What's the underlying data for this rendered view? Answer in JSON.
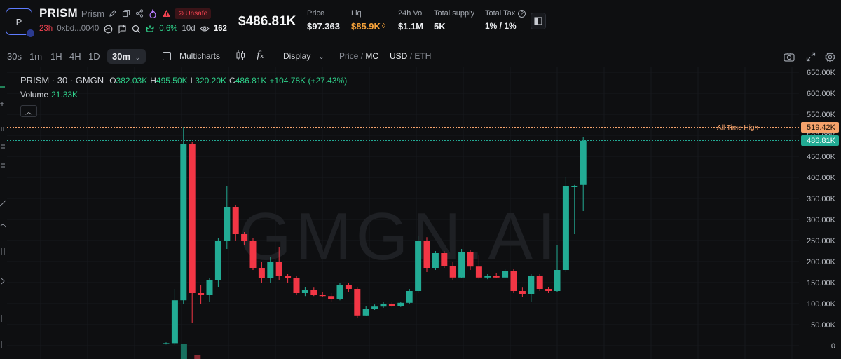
{
  "token": {
    "avatar_letter": "P",
    "symbol": "PRISM",
    "name": "Prism",
    "unsafe_label": "Unsafe",
    "age": "23h",
    "address": "0xbd...0040",
    "change_pct": "0.6%",
    "holder_days": "10d",
    "views": "162"
  },
  "header": {
    "market_cap": "$486.81K",
    "stats": [
      {
        "label": "Price",
        "value": "$97.363"
      },
      {
        "label": "Liq",
        "value": "$85.9K"
      },
      {
        "label": "24h Vol",
        "value": "$1.1M"
      },
      {
        "label": "Total supply",
        "value": "5K"
      },
      {
        "label": "Total Tax",
        "value": "1% / 1%"
      }
    ]
  },
  "toolbar": {
    "timeframes": [
      "30s",
      "1m",
      "1H",
      "4H",
      "1D"
    ],
    "active_timeframe": "30m",
    "multicharts": "Multicharts",
    "display": "Display",
    "price": "Price",
    "mc": "MC",
    "usd": "USD",
    "eth": "ETH"
  },
  "chart": {
    "legend_title": "PRISM · 30 · GMGN",
    "o_label": "O",
    "o_value": "382.03K",
    "h_label": "H",
    "h_value": "495.50K",
    "l_label": "L",
    "l_value": "320.20K",
    "c_label": "C",
    "c_value": "486.81K",
    "change": "+104.78K (+27.43%)",
    "volume_label": "Volume",
    "volume_value": "21.33K",
    "watermark": "GMGN.AI",
    "ath_label": "All Time High",
    "ath_value": "519.42K",
    "last_value": "486.81K",
    "colors": {
      "up": "#22ab94",
      "down": "#f23645",
      "ath": "#f5a26b",
      "bg": "#0e0f11"
    }
  },
  "chart_data": {
    "type": "candlestick",
    "y_ticks": [
      "650.00K",
      "600.00K",
      "550.00K",
      "500.00K",
      "450.00K",
      "400.00K",
      "350.00K",
      "300.00K",
      "250.00K",
      "200.00K",
      "150.00K",
      "100.00K",
      "50.00K",
      "0"
    ],
    "ylim": [
      0,
      650
    ],
    "unit": "K",
    "ath": 519.42,
    "last": 486.81,
    "candles": [
      {
        "o": 5,
        "h": 8,
        "l": 3,
        "c": 6
      },
      {
        "o": 6,
        "h": 135,
        "l": 2,
        "c": 108
      },
      {
        "o": 108,
        "h": 520,
        "l": 100,
        "c": 480
      },
      {
        "o": 480,
        "h": 485,
        "l": 55,
        "c": 125
      },
      {
        "o": 125,
        "h": 145,
        "l": 100,
        "c": 120
      },
      {
        "o": 120,
        "h": 160,
        "l": 105,
        "c": 155
      },
      {
        "o": 155,
        "h": 255,
        "l": 140,
        "c": 250
      },
      {
        "o": 250,
        "h": 380,
        "l": 230,
        "c": 330
      },
      {
        "o": 330,
        "h": 335,
        "l": 250,
        "c": 265
      },
      {
        "o": 265,
        "h": 270,
        "l": 240,
        "c": 250
      },
      {
        "o": 250,
        "h": 255,
        "l": 180,
        "c": 185
      },
      {
        "o": 185,
        "h": 200,
        "l": 150,
        "c": 160
      },
      {
        "o": 160,
        "h": 210,
        "l": 150,
        "c": 200
      },
      {
        "o": 200,
        "h": 235,
        "l": 155,
        "c": 165
      },
      {
        "o": 165,
        "h": 170,
        "l": 150,
        "c": 160
      },
      {
        "o": 160,
        "h": 165,
        "l": 120,
        "c": 125
      },
      {
        "o": 125,
        "h": 140,
        "l": 118,
        "c": 132
      },
      {
        "o": 132,
        "h": 138,
        "l": 118,
        "c": 120
      },
      {
        "o": 120,
        "h": 128,
        "l": 115,
        "c": 118
      },
      {
        "o": 118,
        "h": 125,
        "l": 105,
        "c": 110
      },
      {
        "o": 110,
        "h": 150,
        "l": 108,
        "c": 145
      },
      {
        "o": 145,
        "h": 150,
        "l": 128,
        "c": 135
      },
      {
        "o": 135,
        "h": 138,
        "l": 65,
        "c": 72
      },
      {
        "o": 72,
        "h": 95,
        "l": 70,
        "c": 88
      },
      {
        "o": 88,
        "h": 98,
        "l": 85,
        "c": 93
      },
      {
        "o": 93,
        "h": 105,
        "l": 90,
        "c": 100
      },
      {
        "o": 100,
        "h": 105,
        "l": 92,
        "c": 95
      },
      {
        "o": 95,
        "h": 105,
        "l": 92,
        "c": 102
      },
      {
        "o": 102,
        "h": 135,
        "l": 100,
        "c": 130
      },
      {
        "o": 130,
        "h": 260,
        "l": 125,
        "c": 250
      },
      {
        "o": 250,
        "h": 258,
        "l": 175,
        "c": 185
      },
      {
        "o": 185,
        "h": 225,
        "l": 180,
        "c": 220
      },
      {
        "o": 220,
        "h": 225,
        "l": 185,
        "c": 190
      },
      {
        "o": 190,
        "h": 200,
        "l": 155,
        "c": 162
      },
      {
        "o": 162,
        "h": 230,
        "l": 160,
        "c": 222
      },
      {
        "o": 222,
        "h": 228,
        "l": 180,
        "c": 188
      },
      {
        "o": 188,
        "h": 215,
        "l": 158,
        "c": 162
      },
      {
        "o": 162,
        "h": 170,
        "l": 158,
        "c": 165
      },
      {
        "o": 165,
        "h": 172,
        "l": 160,
        "c": 162
      },
      {
        "o": 162,
        "h": 182,
        "l": 160,
        "c": 178
      },
      {
        "o": 178,
        "h": 182,
        "l": 125,
        "c": 130
      },
      {
        "o": 130,
        "h": 138,
        "l": 115,
        "c": 122
      },
      {
        "o": 122,
        "h": 170,
        "l": 105,
        "c": 165
      },
      {
        "o": 165,
        "h": 170,
        "l": 130,
        "c": 135
      },
      {
        "o": 135,
        "h": 140,
        "l": 125,
        "c": 130
      },
      {
        "o": 130,
        "h": 240,
        "l": 128,
        "c": 180
      },
      {
        "o": 180,
        "h": 400,
        "l": 175,
        "c": 380
      },
      {
        "o": 380,
        "h": 382,
        "l": 265,
        "c": 380
      },
      {
        "o": 382,
        "h": 495,
        "l": 320,
        "c": 487
      }
    ]
  }
}
